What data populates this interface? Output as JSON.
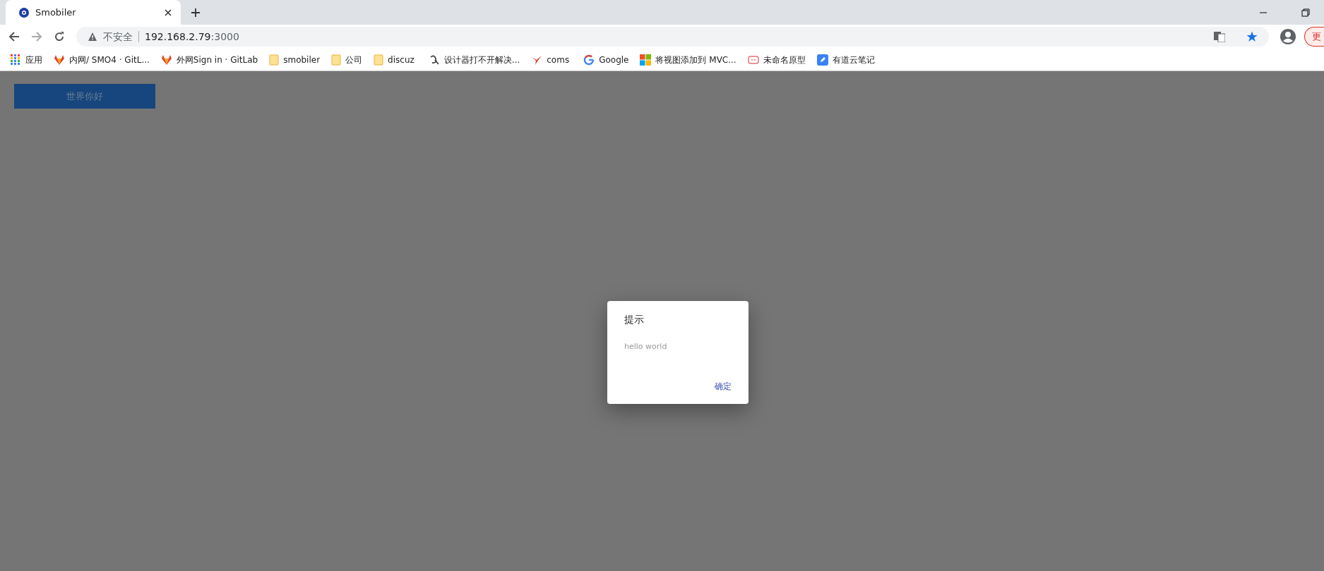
{
  "browser": {
    "tab": {
      "title": "Smobiler",
      "selected": true
    },
    "address": {
      "security": "不安全",
      "host": "192.168.2.79",
      "port": ":3000"
    },
    "update_button": "更"
  },
  "bookmarks": [
    {
      "kind": "apps",
      "label": "应用"
    },
    {
      "kind": "fox",
      "label": "内网/ SMO4 · GitL..."
    },
    {
      "kind": "fox",
      "label": "外网Sign in · GitLab"
    },
    {
      "kind": "folder",
      "label": "smobiler"
    },
    {
      "kind": "folder",
      "label": "公司"
    },
    {
      "kind": "folder",
      "label": "discuz"
    },
    {
      "kind": "swirl",
      "label": "设计器打不开解决..."
    },
    {
      "kind": "bird",
      "label": "coms"
    },
    {
      "kind": "google",
      "label": "Google"
    },
    {
      "kind": "windows",
      "label": "将视图添加到 MVC..."
    },
    {
      "kind": "face",
      "label": "未命名原型"
    },
    {
      "kind": "note",
      "label": "有道云笔记"
    }
  ],
  "page": {
    "button": "世界你好",
    "dialog": {
      "title": "提示",
      "message": "hello world",
      "ok": "确定"
    }
  }
}
